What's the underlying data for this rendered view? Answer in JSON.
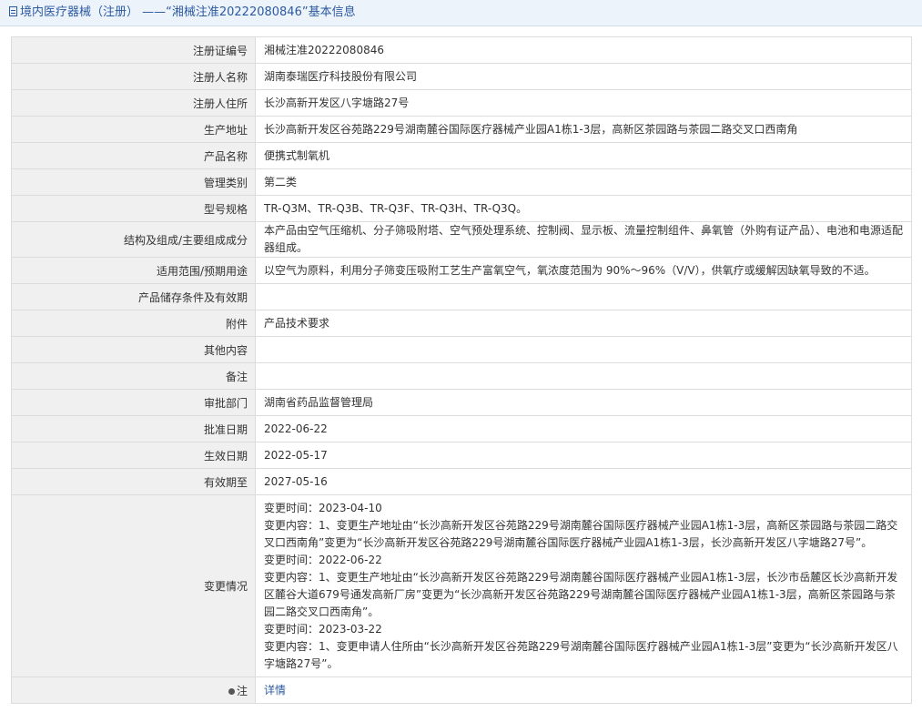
{
  "title": "境内医疗器械（注册） ——“湘械注准20222080846”基本信息",
  "rows": [
    {
      "label": "注册证编号",
      "value": "湘械注准20222080846"
    },
    {
      "label": "注册人名称",
      "value": "湖南泰瑞医疗科技股份有限公司"
    },
    {
      "label": "注册人住所",
      "value": "长沙高新开发区八字塘路27号"
    },
    {
      "label": "生产地址",
      "value": "长沙高新开发区谷苑路229号湖南麓谷国际医疗器械产业园A1栋1-3层，高新区茶园路与茶园二路交叉口西南角"
    },
    {
      "label": "产品名称",
      "value": "便携式制氧机"
    },
    {
      "label": "管理类别",
      "value": "第二类"
    },
    {
      "label": "型号规格",
      "value": "TR-Q3M、TR-Q3B、TR-Q3F、TR-Q3H、TR-Q3Q。"
    },
    {
      "label": "结构及组成/主要组成成分",
      "value": "本产品由空气压缩机、分子筛吸附塔、空气预处理系统、控制阀、显示板、流量控制组件、鼻氧管（外购有证产品）、电池和电源适配器组成。"
    },
    {
      "label": "适用范围/预期用途",
      "value": "以空气为原料，利用分子筛变压吸附工艺生产富氧空气，氧浓度范围为 90%～96%（V/V），供氧疗或缓解因缺氧导致的不适。"
    },
    {
      "label": "产品储存条件及有效期",
      "value": ""
    },
    {
      "label": "附件",
      "value": "产品技术要求"
    },
    {
      "label": "其他内容",
      "value": ""
    },
    {
      "label": "备注",
      "value": ""
    },
    {
      "label": "审批部门",
      "value": "湖南省药品监督管理局"
    },
    {
      "label": "批准日期",
      "value": "2022-06-22"
    },
    {
      "label": "生效日期",
      "value": "2022-05-17"
    },
    {
      "label": "有效期至",
      "value": "2027-05-16"
    }
  ],
  "changes": {
    "label": "变更情况",
    "lines": [
      "变更时间：2023-04-10",
      "变更内容：1、变更生产地址由“长沙高新开发区谷苑路229号湖南麓谷国际医疗器械产业园A1栋1-3层，高新区茶园路与茶园二路交叉口西南角”变更为“长沙高新开发区谷苑路229号湖南麓谷国际医疗器械产业园A1栋1-3层，长沙高新开发区八字塘路27号”。",
      "变更时间：2022-06-22",
      "变更内容：1、变更生产地址由“长沙高新开发区谷苑路229号湖南麓谷国际医疗器械产业园A1栋1-3层，长沙市岳麓区长沙高新开发区麓谷大道679号通发高新厂房”变更为“长沙高新开发区谷苑路229号湖南麓谷国际医疗器械产业园A1栋1-3层，高新区茶园路与茶园二路交叉口西南角”。",
      "变更时间：2023-03-22",
      "变更内容：1、变更申请人住所由“长沙高新开发区谷苑路229号湖南麓谷国际医疗器械产业园A1栋1-3层”变更为“长沙高新开发区八字塘路27号”。"
    ]
  },
  "note": {
    "label": "注",
    "link": "详情",
    "icon": "pin-icon"
  },
  "colors": {
    "accent": "#2c5aa0",
    "label_bg": "#f0f0f0",
    "border": "#dcdcdc"
  }
}
